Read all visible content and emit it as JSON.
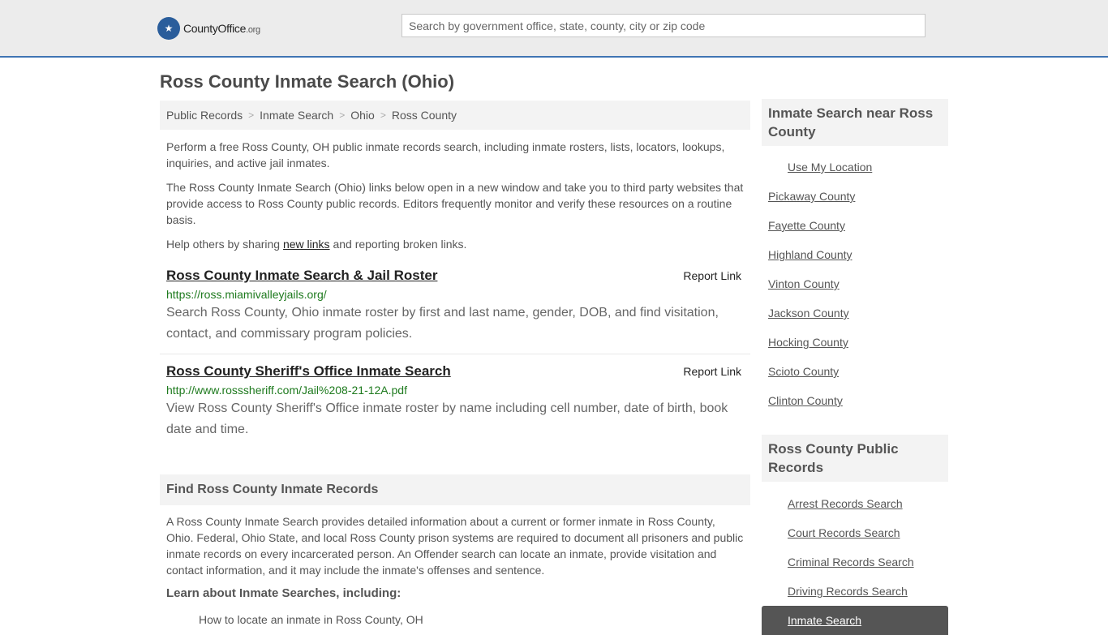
{
  "header": {
    "logo_main": "CountyOffice",
    "logo_suffix": ".org",
    "search_placeholder": "Search by government office, state, county, city or zip code"
  },
  "page_title": "Ross County Inmate Search (Ohio)",
  "breadcrumb": [
    "Public Records",
    "Inmate Search",
    "Ohio",
    "Ross County"
  ],
  "intro": {
    "p1": "Perform a free Ross County, OH public inmate records search, including inmate rosters, lists, locators, lookups, inquiries, and active jail inmates.",
    "p2": "The Ross County Inmate Search (Ohio) links below open in a new window and take you to third party websites that provide access to Ross County public records. Editors frequently monitor and verify these resources on a routine basis.",
    "p3_before": "Help others by sharing ",
    "p3_link": "new links",
    "p3_after": " and reporting broken links."
  },
  "results": [
    {
      "title": "Ross County Inmate Search & Jail Roster",
      "report": "Report Link",
      "url": "https://ross.miamivalleyjails.org/",
      "desc": "Search Ross County, Ohio inmate roster by first and last name, gender, DOB, and find visitation, contact, and commissary program policies."
    },
    {
      "title": "Ross County Sheriff's Office Inmate Search",
      "report": "Report Link",
      "url": "http://www.rosssheriff.com/Jail%208-21-12A.pdf",
      "desc": "View Ross County Sheriff's Office inmate roster by name including cell number, date of birth, book date and time."
    }
  ],
  "find_section": {
    "heading": "Find Ross County Inmate Records",
    "text": "A Ross County Inmate Search provides detailed information about a current or former inmate in Ross County, Ohio. Federal, Ohio State, and local Ross County prison systems are required to document all prisoners and public inmate records on every incarcerated person. An Offender search can locate an inmate, provide visitation and contact information, and it may include the inmate's offenses and sentence.",
    "learn": "Learn about Inmate Searches, including:",
    "first_item": "How to locate an inmate in Ross County, OH"
  },
  "sidebar_nearby": {
    "heading": "Inmate Search near Ross County",
    "use_location": "Use My Location",
    "counties": [
      "Pickaway County",
      "Fayette County",
      "Highland County",
      "Vinton County",
      "Jackson County",
      "Hocking County",
      "Scioto County",
      "Clinton County"
    ]
  },
  "sidebar_records": {
    "heading": "Ross County Public Records",
    "items": [
      "Arrest Records Search",
      "Court Records Search",
      "Criminal Records Search",
      "Driving Records Search",
      "Inmate Search"
    ]
  }
}
